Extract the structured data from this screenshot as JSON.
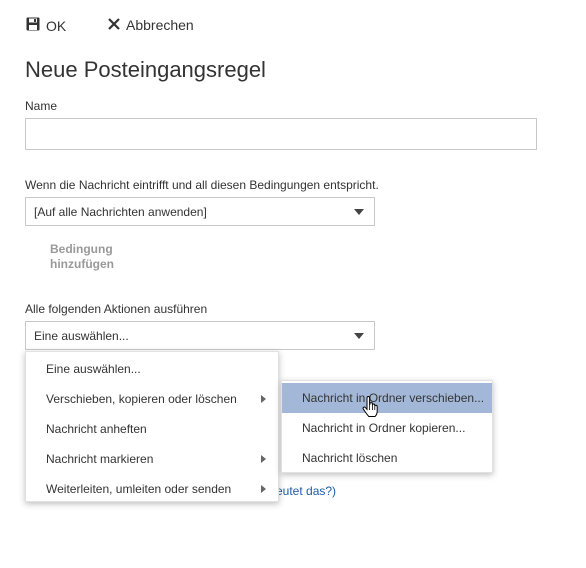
{
  "toolbar": {
    "ok_label": "OK",
    "cancel_label": "Abbrechen"
  },
  "form": {
    "title": "Neue Posteingangsregel",
    "name_label": "Name",
    "name_value": "",
    "condition_label": "Wenn die Nachricht eintrifft und all diesen Bedingungen entspricht.",
    "condition_value": "[Auf alle Nachrichten anwenden]",
    "add_condition_line1": "Bedingung",
    "add_condition_line2": "hinzufügen",
    "action_label": "Alle folgenden Aktionen ausführen",
    "action_value": "Eine auswählen..."
  },
  "action_menu": {
    "items": [
      {
        "label": "Eine auswählen..."
      },
      {
        "label": "Verschieben, kopieren oder löschen"
      },
      {
        "label": "Nachricht anheften"
      },
      {
        "label": "Nachricht markieren"
      },
      {
        "label": "Weiterleiten, umleiten oder senden"
      }
    ]
  },
  "submenu": {
    "items": [
      {
        "label": "Nachricht in Ordner verschieben...",
        "highlighted": true
      },
      {
        "label": "Nachricht in Ordner kopieren..."
      },
      {
        "label": "Nachricht löschen"
      }
    ]
  },
  "partial_link": "eutet das?)",
  "colors": {
    "highlight": "#a3b8d8",
    "link": "#1e5ba8"
  },
  "icons": [
    "save-icon",
    "close-icon",
    "chevron-right-icon",
    "hand-cursor-icon"
  ]
}
